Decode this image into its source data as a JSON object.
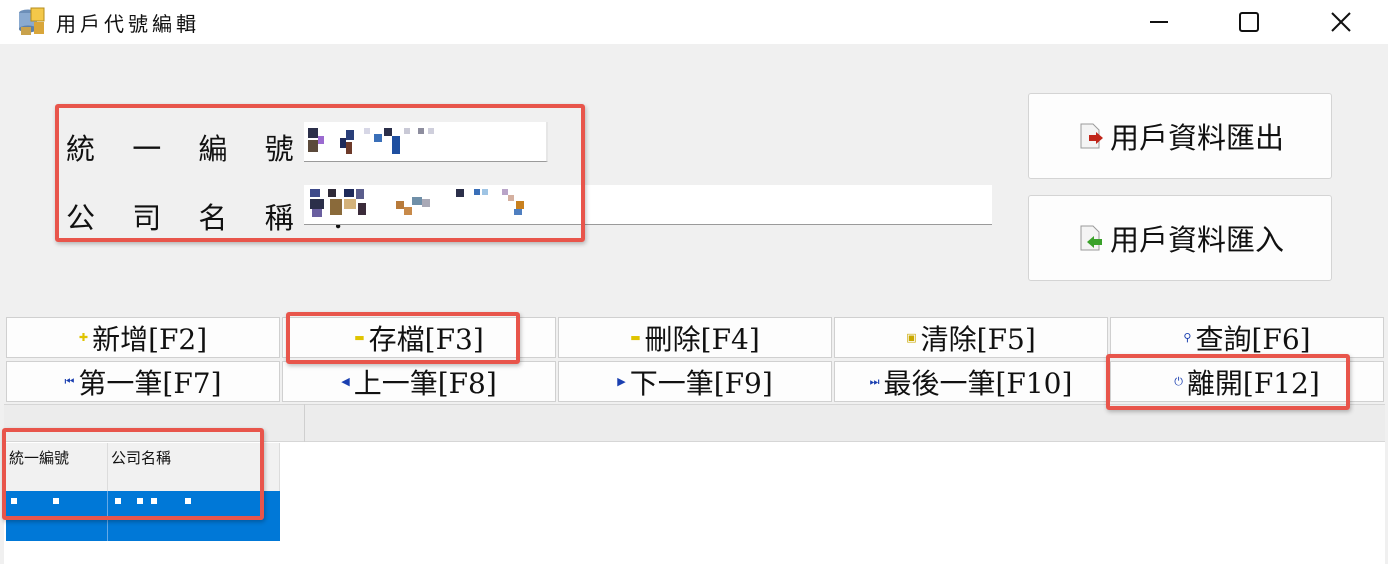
{
  "window": {
    "title": "用戶代號編輯",
    "icon": "app-db-icon",
    "controls": [
      "minimize-icon",
      "maximize-icon",
      "close-icon"
    ]
  },
  "form": {
    "tax_id_label": "統 一 編 號 ：",
    "company_name_label": "公 司 名 稱 ："
  },
  "side_buttons": {
    "export_label": "用戶資料匯出",
    "import_label": "用戶資料匯入"
  },
  "toolbar": {
    "new_label": "新增[F2]",
    "save_label": "存檔[F3]",
    "delete_label": "刪除[F4]",
    "clear_label": "清除[F5]",
    "query_label": "查詢[F6]",
    "first_label": "第一筆[F7]",
    "prev_label": "上一筆[F8]",
    "next_label": "下一筆[F9]",
    "last_label": "最後一筆[F10]",
    "exit_label": "離開[F12]"
  },
  "grid": {
    "columns": [
      "統一編號",
      "公司名稱"
    ]
  },
  "colors": {
    "selection": "#0078d7",
    "annotation": "#e8554b"
  }
}
